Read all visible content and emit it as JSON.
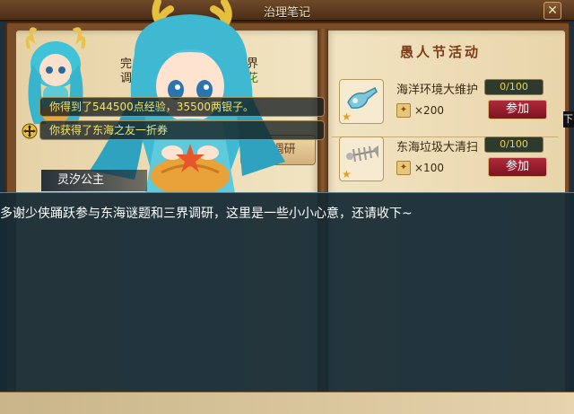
{
  "window": {
    "title": "治理笔记",
    "close_glyph": "✕"
  },
  "quest_panel": {
    "line1": "完成",
    "line2": "调",
    "right1": "三界",
    "right2": "红花",
    "research_button": "界调研"
  },
  "event": {
    "title": "愚人节活动",
    "items": [
      {
        "name": "海洋环境大维护",
        "progress": "0/100",
        "reward_qty": "×200",
        "join_label": "参加",
        "icon": "blue-bottle-icon"
      },
      {
        "name": "东海垃圾大清扫",
        "progress": "0/100",
        "reward_qty": "×100",
        "join_label": "参加",
        "icon": "fish-bone-icon"
      }
    ]
  },
  "notifications": [
    "你得到了544500点经验，35500两银子。",
    "你获得了东海之友一折券"
  ],
  "side_tab": "下",
  "npc": {
    "name": "灵汐公主"
  },
  "dialog": {
    "text": "多谢少侠踊跃参与东海谜题和三界调研，这里是一些小小心意，还请收下~"
  },
  "colors": {
    "accent_gold": "#f0e46a",
    "join_red": "#9a1f2e",
    "dialog_bg": "#162a34"
  }
}
